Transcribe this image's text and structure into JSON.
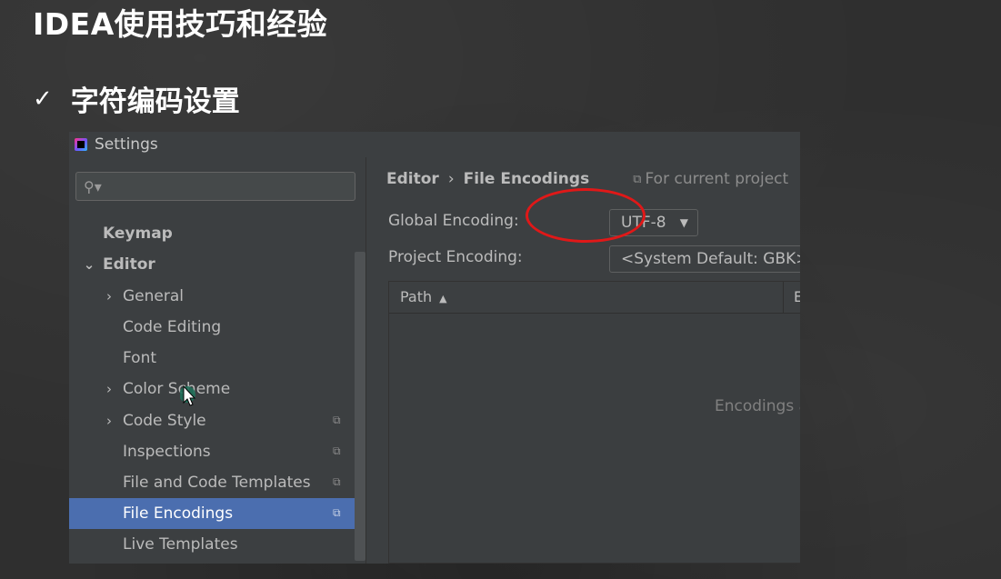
{
  "slide": {
    "title": "IDEA使用技巧和经验",
    "bullet_mark": "✓",
    "bullet_text": "字符编码设置"
  },
  "window": {
    "title": "Settings",
    "icon": "intellij-idea-icon"
  },
  "sidebar": {
    "search_placeholder": "",
    "items": [
      {
        "label": "Keymap",
        "bold": true
      },
      {
        "label": "Editor",
        "bold": true,
        "expanded": true
      },
      {
        "label": "General",
        "expandable": true
      },
      {
        "label": "Code Editing"
      },
      {
        "label": "Font"
      },
      {
        "label": "Color Scheme",
        "expandable": true
      },
      {
        "label": "Code Style",
        "expandable": true,
        "project_icon": true
      },
      {
        "label": "Inspections",
        "project_icon": true
      },
      {
        "label": "File and Code Templates",
        "project_icon": true
      },
      {
        "label": "File Encodings",
        "project_icon": true,
        "selected": true
      },
      {
        "label": "Live Templates"
      }
    ]
  },
  "content": {
    "breadcrumb": [
      "Editor",
      "File Encodings"
    ],
    "scope_label": "For current project",
    "global_encoding_label": "Global Encoding:",
    "global_encoding_value": "UTF-8",
    "project_encoding_label": "Project Encoding:",
    "project_encoding_value": "<System Default: GBK>",
    "table": {
      "columns": [
        "Path",
        "E"
      ],
      "empty_text": "Encodings a"
    }
  },
  "colors": {
    "window_bg": "#3c3f41",
    "selection": "#4b6eaf",
    "annotation": "#e01818"
  }
}
